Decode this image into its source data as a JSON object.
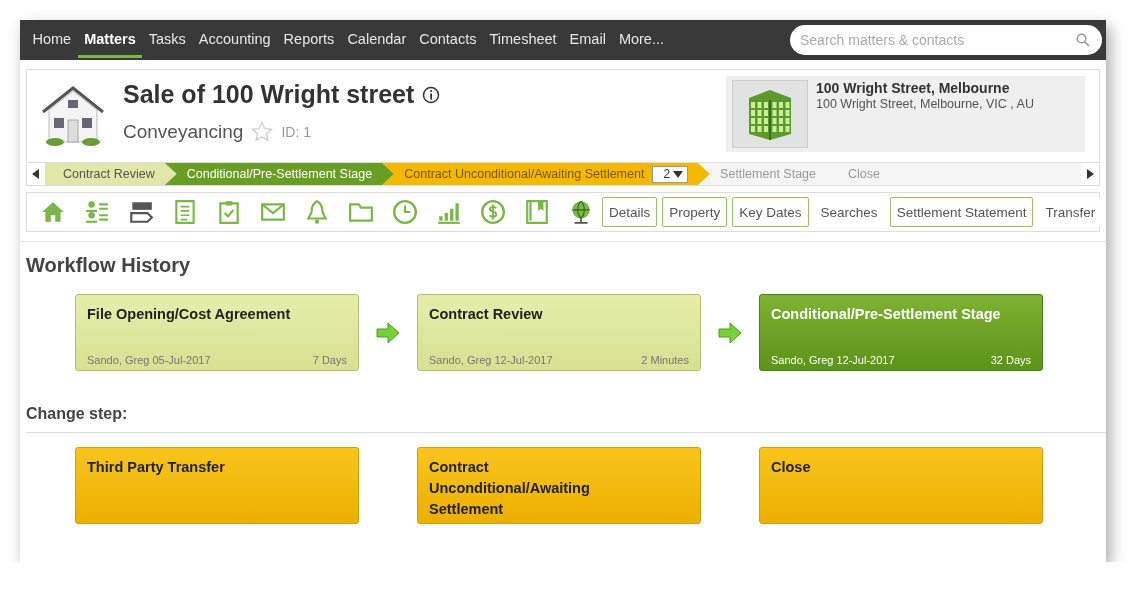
{
  "nav": {
    "items": [
      {
        "label": "Home",
        "selected": false
      },
      {
        "label": "Matters",
        "selected": true
      },
      {
        "label": "Tasks",
        "selected": false
      },
      {
        "label": "Accounting",
        "selected": false
      },
      {
        "label": "Reports",
        "selected": false
      },
      {
        "label": "Calendar",
        "selected": false
      },
      {
        "label": "Contacts",
        "selected": false
      },
      {
        "label": "Timesheet",
        "selected": false
      },
      {
        "label": "Email",
        "selected": false
      },
      {
        "label": "More...",
        "selected": false
      }
    ],
    "search": {
      "placeholder": "Search matters & contacts"
    }
  },
  "matter": {
    "title": "Sale of 100 Wright street",
    "type": "Conveyancing",
    "starred": false,
    "id": "ID: 1",
    "property_name": "100 Wright Street, Melbourne",
    "property_address": "100 Wright Street, Melbourne, VIC , AU"
  },
  "stages": [
    {
      "label": "Contract Review",
      "kind": "done"
    },
    {
      "label": "Conditional/Pre-Settlement Stage",
      "kind": "current"
    },
    {
      "label": "Contract Unconditional/Awaiting Settlement",
      "kind": "next",
      "count": "2"
    },
    {
      "label": "Settlement Stage",
      "kind": "future"
    },
    {
      "label": "Close",
      "kind": "future"
    }
  ],
  "tabs": [
    {
      "label": "Details",
      "bordered": true
    },
    {
      "label": "Property",
      "bordered": true
    },
    {
      "label": "Key Dates",
      "bordered": true
    },
    {
      "label": "Searches",
      "bordered": false
    },
    {
      "label": "Settlement Statement",
      "bordered": true
    },
    {
      "label": "Transfer",
      "bordered": false
    }
  ],
  "history": {
    "title": "Workflow History",
    "steps": [
      {
        "title": "File Opening/Cost Agreement",
        "by": "Sando, Greg 05-Jul-2017",
        "duration": "7 Days",
        "current": false
      },
      {
        "title": "Contract Review",
        "by": "Sando, Greg 12-Jul-2017",
        "duration": "2 Minutes",
        "current": false
      },
      {
        "title": "Conditional/Pre-Settlement Stage",
        "by": "Sando, Greg 12-Jul-2017",
        "duration": "32 Days",
        "current": true
      }
    ]
  },
  "change_step": {
    "title": "Change step:",
    "options": [
      {
        "label": "Third Party Transfer"
      },
      {
        "label": "Contract Unconditional/Awaiting Settlement"
      },
      {
        "label": "Close"
      }
    ]
  }
}
